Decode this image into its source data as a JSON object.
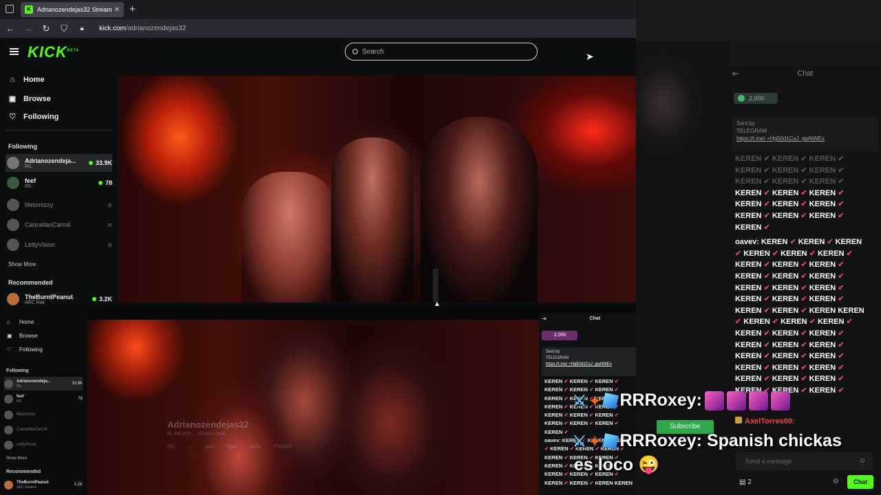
{
  "browser": {
    "tab_title": "Adrianozendejas32 Stream",
    "tab_favicon": "K",
    "url_domain": "kick.com",
    "url_path": "/adrianozendejas32"
  },
  "header": {
    "logo": "KICK",
    "logo_badge": "BETA",
    "search_placeholder": "Search"
  },
  "sidebar": {
    "nav": [
      {
        "label": "Home",
        "icon": "home-icon"
      },
      {
        "label": "Browse",
        "icon": "browse-icon"
      },
      {
        "label": "Following",
        "icon": "heart-icon"
      }
    ],
    "following_heading": "Following",
    "following": [
      {
        "name": "Adrianozendeja...",
        "category": "IRL",
        "viewers": "33.9K",
        "live": true
      },
      {
        "name": "feef",
        "category": "IRL",
        "viewers": "78",
        "live": true
      },
      {
        "name": "lifeismizzy",
        "live": false
      },
      {
        "name": "CancellanCarroll",
        "live": false
      },
      {
        "name": "LettyVision",
        "live": false
      }
    ],
    "show_more": "Show More",
    "recommended_heading": "Recommended",
    "recommended": [
      {
        "name": "TheBurntPeanut",
        "category": "ARC Rak",
        "viewers": "3.2K"
      }
    ]
  },
  "embed": {
    "nav": [
      "Home",
      "Browse",
      "Following"
    ],
    "following_heading": "Following",
    "following": [
      {
        "name": "Adrianozendeja...",
        "category": "IRL",
        "viewers": "33.9K"
      },
      {
        "name": "feef",
        "category": "IRL",
        "viewers": "78"
      },
      {
        "name": "lifeismizzy"
      },
      {
        "name": "CancellanCarroll"
      },
      {
        "name": "LettyVision"
      }
    ],
    "show_more": "Show More",
    "recommended_heading": "Recommended",
    "recommended": [
      {
        "name": "TheBurntPeanut",
        "category": "ARC Raiders",
        "viewers": "3.2K"
      }
    ],
    "ghost_title": "Adrianozendejas32",
    "ghost_sub": "EL MEJOR ... GDMX / SHE...",
    "ghost_tags": "IRL ... just figar shifu PRIMO"
  },
  "embed_chat": {
    "title": "Chat",
    "pill": "2,000",
    "sent_by": "Sent by",
    "telegram": "TELEGRAM",
    "link": "https://t.me/ +Hg50d1CsJ_gwNWEx",
    "lines": [
      "KEREN ✔ KEREN ✔ KEREN ✔",
      "KEREN ✔ KEREN ✔ KEREN ✔",
      "KEREN ✔ KEREN ✔ KEREN ✔",
      "KEREN ✔ KEREN ✔ KEREN ✔",
      "KEREN ✔ KEREN ✔ KEREN ✔",
      "KEREN ✔ KEREN ✔ KEREN ✔",
      "KEREN ✔",
      "oavev: KEREN ✔ KEREN ✔ KEREN",
      "✔ KEREN ✔ KEREN ✔ KEREN ✔",
      "KEREN ✔ KEREN ✔ KEREN ✔",
      "KEREN ✔ KEREN ✔ KEREN ✔",
      "KEREN ✔ KEREN ✔ KEREN ✔",
      "KEREN ✔ KEREN ✔ KEREN KEREN"
    ]
  },
  "chat": {
    "title": "Chat",
    "pill": "2,000",
    "sent_by": "Sent by",
    "telegram": "TELEGRAM",
    "link": "https://t.me/ +Hg50d1CsJ_gwNWEx",
    "faded_lines": [
      "KEREN ✔ KEREN ✔ KEREN ✔",
      "KEREN ✔ KEREN ✔ KEREN ✔",
      "KEREN ✔ KEREN ✔ KEREN ✔"
    ],
    "lines": [
      "KEREN ✔ KEREN ✔ KEREN ✔",
      "KEREN ✔ KEREN ✔ KEREN ✔",
      "KEREN ✔ KEREN ✔ KEREN ✔",
      "KEREN ✔"
    ],
    "oavev_user": "oavev:",
    "oavev_first": "KEREN ✔ KEREN ✔ KEREN",
    "oavev_lines": [
      "✔ KEREN ✔ KEREN ✔ KEREN ✔",
      "KEREN ✔ KEREN ✔ KEREN ✔",
      "KEREN ✔ KEREN ✔ KEREN ✔",
      "KEREN ✔ KEREN ✔ KEREN ✔",
      "KEREN ✔ KEREN ✔ KEREN ✔",
      "KEREN ✔ KEREN ✔ KEREN KEREN",
      "✔ KEREN ✔ KEREN ✔ KEREN ✔",
      "KEREN ✔ KEREN ✔ KEREN ✔",
      "KEREN ✔ KEREN ✔ KEREN ✔",
      "KEREN ✔ KEREN ✔ KEREN ✔",
      "KEREN ✔ KEREN ✔ KEREN ✔",
      "KEREN ✔ KEREN ✔ KEREN ✔",
      "KEREN ✔ KEREN ✔ KEREN ✔"
    ],
    "axel": "AxelTorres00:",
    "send_placeholder": "Send a message",
    "points": "2",
    "chat_button": "Chat"
  },
  "overlay": {
    "tts1_user": "RRRoxey:",
    "tts2_user": "RRRoxey:",
    "tts2_msg": "Spanish chickas",
    "tts3_msg": "es loco",
    "tts3_emoji": "😜",
    "subscribe": "Subscribe"
  },
  "colors": {
    "brand": "#53fc18",
    "heart": "#e23b8a"
  }
}
